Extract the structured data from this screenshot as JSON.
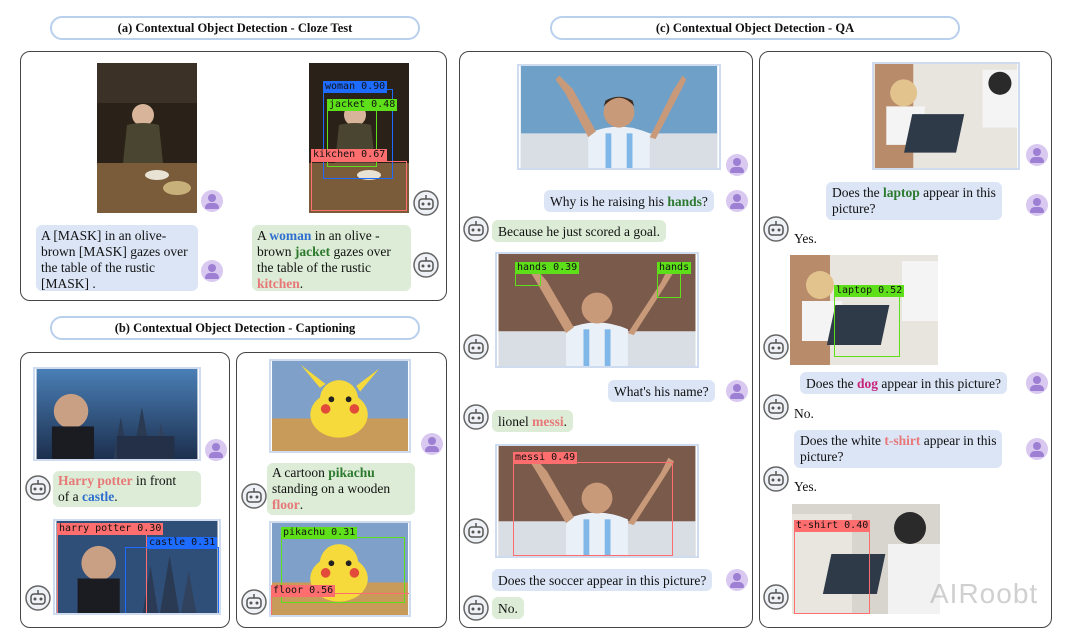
{
  "titles": {
    "a": "(a) Contextual Object Detection - Cloze Test",
    "b": "(b) Contextual Object Detection - Captioning",
    "c": "(c) Contextual Object Detection - QA"
  },
  "cloze": {
    "question": [
      "A [MASK] in an olive-",
      "brown [MASK] gazes over",
      "the table of the rustic",
      "[MASK] ."
    ],
    "answer": {
      "l1_pre": "A ",
      "l1_w": "woman",
      "l1_post": " in an olive -",
      "l2_pre": "brown ",
      "l2_w": "jacket",
      "l2_post": " gazes over",
      "l3": "the table of the rustic",
      "l4_w": "kitchen",
      "l4_post": "."
    },
    "detections": [
      {
        "label": "woman 0.90",
        "color": "#1e6cff"
      },
      {
        "label": "jacket 0.48",
        "color": "#5de01a"
      },
      {
        "label": "kikchen 0.67",
        "color": "#ff6e6e"
      }
    ]
  },
  "caption": {
    "harry": {
      "w1": "Harry potter",
      "t1": " in front",
      "t2": "of a ",
      "w2": "castle",
      "t3": "."
    },
    "harry_dets": [
      {
        "label": "harry potter 0.30",
        "color": "#ff6e6e"
      },
      {
        "label": "castle 0.31",
        "color": "#1e6cff"
      }
    ],
    "pikachu": {
      "l1": "A cartoon ",
      "w1": "pikachu",
      "l2": "standing on a wooden",
      "w2": "floor",
      "t3": "."
    },
    "pikachu_dets": [
      {
        "label": "pikachu 0.31",
        "color": "#5de01a"
      },
      {
        "label": "floor 0.56",
        "color": "#ff6e6e"
      }
    ]
  },
  "qa_left": {
    "q1_pre": "Why is he raising his ",
    "q1_w": "hands",
    "q1_post": "?",
    "a1": "Because he just scored a goal.",
    "hands_dets": [
      {
        "label": "hands 0.39",
        "color": "#5de01a"
      },
      {
        "label": "hands",
        "color": "#5de01a"
      }
    ],
    "q2": "What's his name?",
    "a2_pre": "lionel ",
    "a2_w": "messi",
    "a2_post": ".",
    "messi_det": {
      "label": "messi 0.49",
      "color": "#ff6e6e"
    },
    "q3": "Does the soccer appear in this picture?",
    "a3": "No."
  },
  "qa_right": {
    "q1_l1_pre": "Does the ",
    "q1_w": "laptop",
    "q1_l1_post": " appear in this",
    "q1_l2": "picture?",
    "a1": "Yes.",
    "laptop_det": {
      "label": "laptop 0.52",
      "color": "#5de01a"
    },
    "q2_pre": "Does the ",
    "q2_w": "dog",
    "q2_post": " appear in this picture?",
    "a2": "No.",
    "q3_l1_pre": "Does the white ",
    "q3_w": "t-shirt",
    "q3_l1_post": " appear in this",
    "q3_l2": "picture?",
    "a3": "Yes.",
    "tshirt_det": {
      "label": "t-shirt 0.40",
      "color": "#ff6e6e"
    }
  },
  "watermark": "AIRoobt"
}
